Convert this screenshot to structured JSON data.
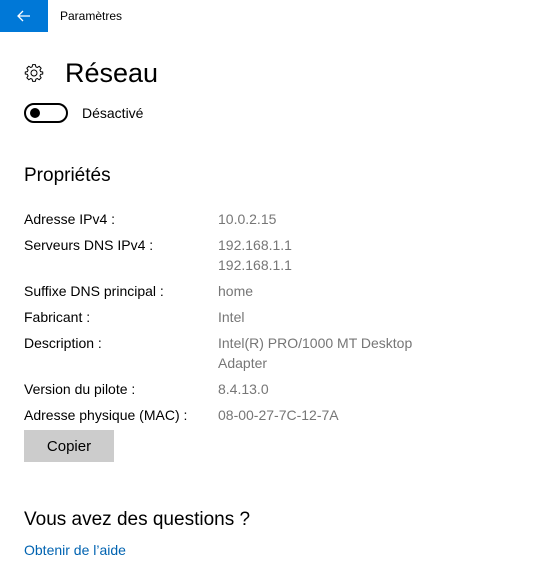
{
  "window": {
    "title": "Paramètres",
    "back_icon": "back-arrow-icon"
  },
  "header": {
    "icon": "gear-icon",
    "title": "Réseau"
  },
  "toggle": {
    "state": "off",
    "label": "Désactivé"
  },
  "properties": {
    "title": "Propriétés",
    "rows": [
      {
        "label": "Adresse IPv4 :",
        "values": [
          "10.0.2.15"
        ]
      },
      {
        "label": "Serveurs DNS IPv4 :",
        "values": [
          "192.168.1.1",
          "192.168.1.1"
        ]
      },
      {
        "label": "Suffixe DNS principal :",
        "values": [
          "home"
        ]
      },
      {
        "label": "Fabricant :",
        "values": [
          "Intel"
        ]
      },
      {
        "label": "Description :",
        "values": [
          "Intel(R) PRO/1000 MT Desktop",
          "Adapter"
        ]
      },
      {
        "label": "Version du pilote :",
        "values": [
          "8.4.13.0"
        ]
      },
      {
        "label": "Adresse physique (MAC) :",
        "values": [
          "08-00-27-7C-12-7A"
        ]
      }
    ],
    "copy_label": "Copier"
  },
  "help": {
    "title": "Vous avez des questions ?",
    "link": "Obtenir de l’aide"
  },
  "colors": {
    "accent": "#0078d7",
    "link": "#0063b1",
    "secondary_text": "#767676",
    "button_bg": "#cccccc"
  }
}
